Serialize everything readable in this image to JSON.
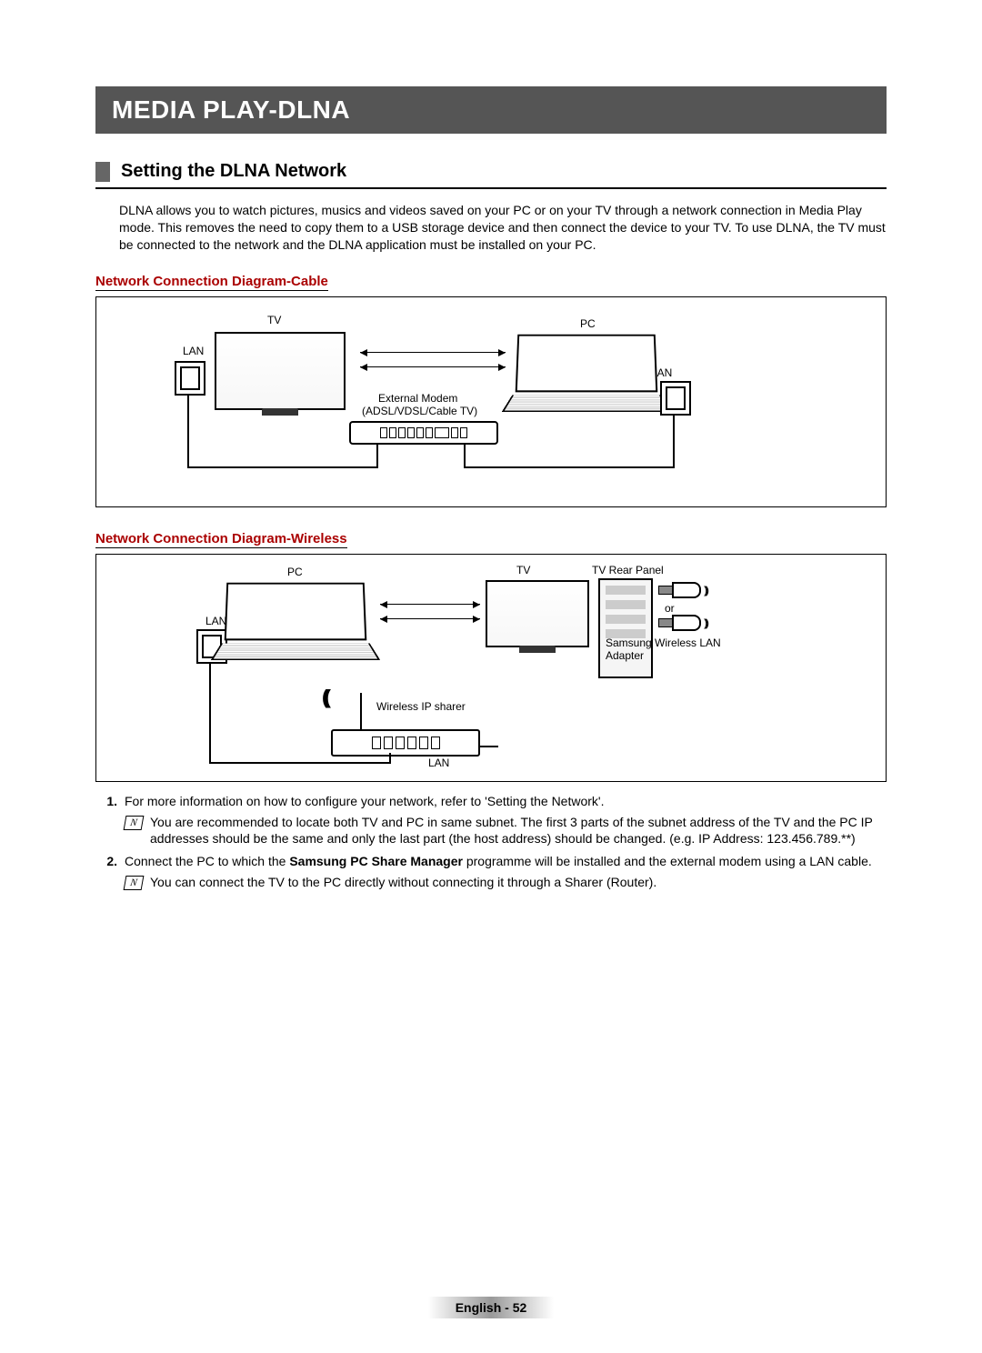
{
  "title": "MEDIA PLAY-DLNA",
  "section_heading": "Setting the DLNA Network",
  "intro": "DLNA allows you to watch pictures, musics and videos saved on your PC or on your TV through a network connection in Media Play mode. This removes the need to copy them to a USB storage device and then connect the device to your TV. To use DLNA, the TV must be connected to the network and the DLNA application must be installed on your PC.",
  "diagram_cable": {
    "heading": "Network Connection Diagram-Cable",
    "labels": {
      "tv": "TV",
      "pc": "PC",
      "lan_left": "LAN",
      "lan_right": "LAN",
      "modem1": "External Modem",
      "modem2": "(ADSL/VDSL/Cable TV)"
    }
  },
  "diagram_wireless": {
    "heading": "Network Connection Diagram-Wireless",
    "labels": {
      "pc": "PC",
      "tv": "TV",
      "rear": "TV Rear Panel",
      "lan": "LAN",
      "lan_router": "LAN",
      "router": "Wireless IP sharer",
      "or": "or",
      "adapter": "Samsung Wireless LAN Adapter"
    }
  },
  "list": {
    "item1": {
      "num": "1.",
      "text": "For more information on how to configure your network, refer to 'Setting the Network'.",
      "note": "You are recommended to locate both TV and PC in same subnet. The first 3 parts of the subnet address of the TV and the PC IP addresses should be the same and only the last part (the host address) should be changed. (e.g. IP Address: 123.456.789.**)"
    },
    "item2": {
      "num": "2.",
      "lead": "Connect the PC to which the ",
      "bold": "Samsung PC Share Manager",
      "tail": " programme will be installed and the external modem using a LAN cable.",
      "note": "You can connect the TV to the PC directly without connecting it through a Sharer (Router)."
    }
  },
  "footer": "English - 52"
}
